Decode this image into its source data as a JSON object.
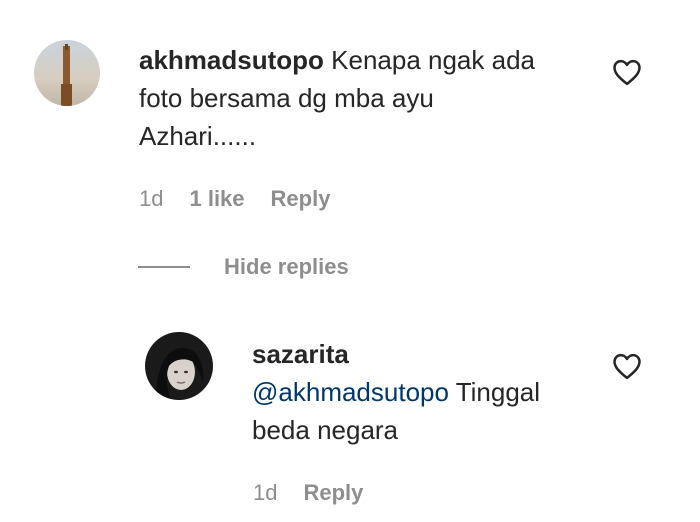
{
  "comment": {
    "username": "akhmadsutopo",
    "text_line1": " Kenapa ngak ada",
    "text_line2": "foto bersama dg mba ayu",
    "text_line3": "Azhari......",
    "time": "1d",
    "likes": "1 like",
    "reply_label": "Reply",
    "like_icon": "heart-outline-icon"
  },
  "hide_replies": {
    "label": "Hide replies"
  },
  "reply": {
    "username": "sazarita",
    "mention": "@akhmadsutopo",
    "text_line1": " Tinggal",
    "text_line2": "beda negara",
    "time": "1d",
    "reply_label": "Reply",
    "like_icon": "heart-outline-icon"
  },
  "colors": {
    "text": "#262626",
    "secondary": "#8e8e8e",
    "mention": "#00376b"
  }
}
